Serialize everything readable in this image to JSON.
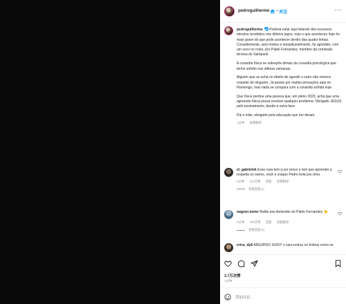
{
  "header": {
    "username": "pedroguilherme",
    "follow_label": "关注",
    "separator": "•",
    "more_label": "···"
  },
  "caption": {
    "username": "pedroguilherme",
    "paragraphs": [
      "Poderia estar aqui falando dos escassos minutos recebidos nos últimos jogos, mas o que aconteceu hoje foi mais grave do que pode acontecer dentro das quatro linhas. Covardemente, sem motivo e inexplicavelmente, fui agredido, com um soco no rosto, por Pablo Fernandez, membro da comissão técnica do Sampaoli.",
      "A covardia física se sobrepôs dimais da covardia psicológica que tenho sofrido nas últimas semanas.",
      "Alguém que se acha no direito de agredir o outro não merece respeito de ninguém. Já passei por muitas provações aqui no Flamengo, mas nada se compara com a covardia sofrida hoje.",
      "Que Deus perdoe uma pessoa que, em pleno 2023, acha que uma agressão física possa resolver qualquer problema. Obrigado JESUS pelo ensinamento, dando a outra face.",
      "Pai e mãe, obrigado pela educação que me deram."
    ],
    "time": "1分钟",
    "translate": "查看翻译"
  },
  "comments": [
    {
      "username": "el_gabrielzk",
      "text": "Esse cara tem q ser preso e tem que aprender a respeita os outros, você é craque Pedro bola pra cima",
      "time": "2分钟",
      "likes": "342次赞",
      "reply": "回复",
      "translate": "查看翻译",
      "replies": "查看回复(1)"
    },
    {
      "username": "wagner.meier",
      "text": "Botão pra demissão do Pablo Fernandez 👏",
      "time": "2分钟",
      "likes": "796次赞",
      "reply": "回复",
      "translate": "查看翻译",
      "replies": "查看回复(4)"
    },
    {
      "username": "erica_dp5",
      "text": "ABSURDO ISSO!! o cara entrou no ônibus como se"
    }
  ],
  "actions": {
    "likes": "3.7万次赞",
    "date": "1分钟",
    "comment_placeholder": "添加评论..."
  },
  "icons": [
    "heart-icon",
    "comment-icon",
    "share-icon",
    "bookmark-icon",
    "emoji-icon",
    "more-icon",
    "verified-icon"
  ]
}
